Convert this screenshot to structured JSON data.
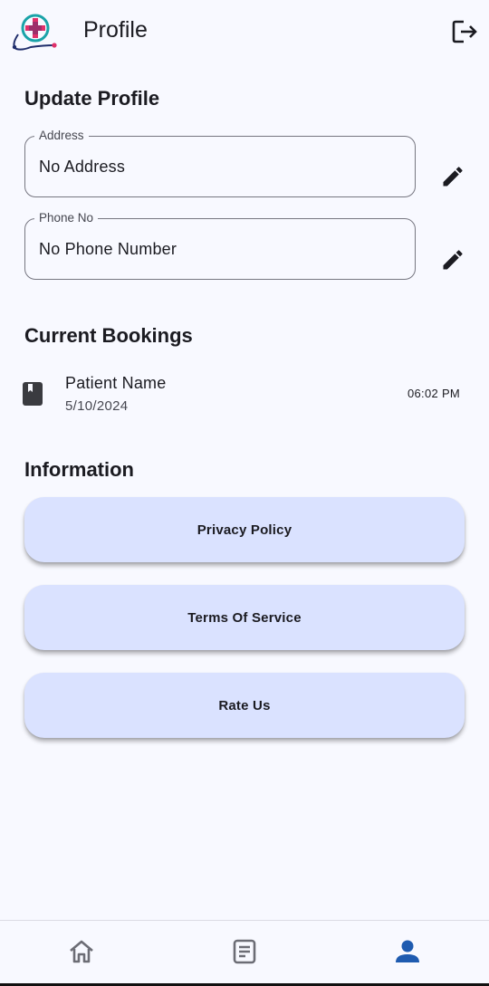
{
  "app_bar": {
    "title": "Profile",
    "logo_icon": "medical-cross-stethoscope-logo",
    "logout_icon": "logout-icon"
  },
  "update_profile": {
    "title": "Update Profile",
    "address": {
      "label": "Address",
      "value": "No Address"
    },
    "phone": {
      "label": "Phone No",
      "value": "No Phone Number"
    },
    "edit_icon": "pencil-icon"
  },
  "current_bookings": {
    "title": "Current Bookings",
    "items": [
      {
        "name": "Patient Name",
        "date": "5/10/2024",
        "time": "06:02 PM",
        "icon": "book-icon"
      }
    ]
  },
  "information": {
    "title": "Information",
    "buttons": [
      {
        "label": "Privacy Policy"
      },
      {
        "label": "Terms Of Service"
      },
      {
        "label": "Rate Us"
      }
    ]
  },
  "bottom_nav": {
    "items": [
      {
        "icon": "home-icon",
        "active": false
      },
      {
        "icon": "document-icon",
        "active": false
      },
      {
        "icon": "person-icon",
        "active": true
      }
    ]
  },
  "colors": {
    "background": "#f8f9ff",
    "button_fill": "#dae2ff",
    "accent_active": "#1e5bb0",
    "logo_teal": "#1aa3a8",
    "logo_pink": "#e0306a",
    "logo_navy": "#1f2d6b"
  }
}
